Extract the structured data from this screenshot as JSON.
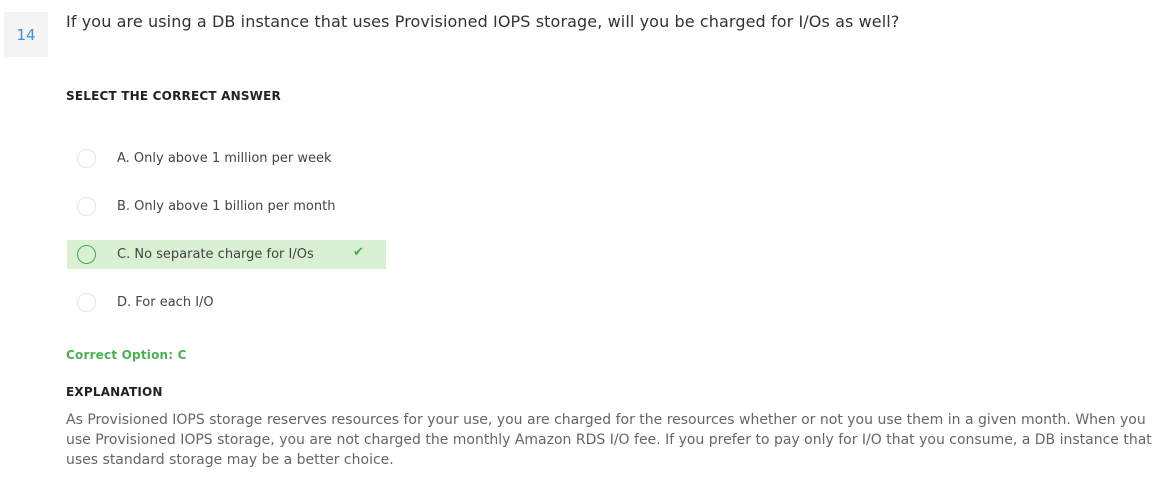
{
  "question": {
    "number": "14",
    "text": "If you are using a DB instance that uses Provisioned IOPS storage, will you be charged for I/Os as well?"
  },
  "select_label": "SELECT THE CORRECT ANSWER",
  "options": [
    {
      "text": "A. Only above 1 million per week",
      "correct": false
    },
    {
      "text": "B. Only above 1 billion per month",
      "correct": false
    },
    {
      "text": "C. No separate charge for I/Os",
      "correct": true
    },
    {
      "text": "D. For each I/O",
      "correct": false
    }
  ],
  "correct_option": "Correct Option: C",
  "explanation": {
    "label": "EXPLANATION",
    "text": "As Provisioned IOPS storage reserves resources for your use, you are charged for the resources whether or not you use them in a given month. When you use Provisioned IOPS storage, you are not charged the monthly Amazon RDS I/O fee. If you prefer to pay only for I/O that you consume, a DB instance that uses standard storage may be a better choice."
  },
  "icons": {
    "check": "check-icon",
    "radio": "radio-icon"
  },
  "colors": {
    "correct_bg": "#d9f0d3",
    "correct_accent": "#4aa64a",
    "question_number": "#3d8fd6"
  }
}
